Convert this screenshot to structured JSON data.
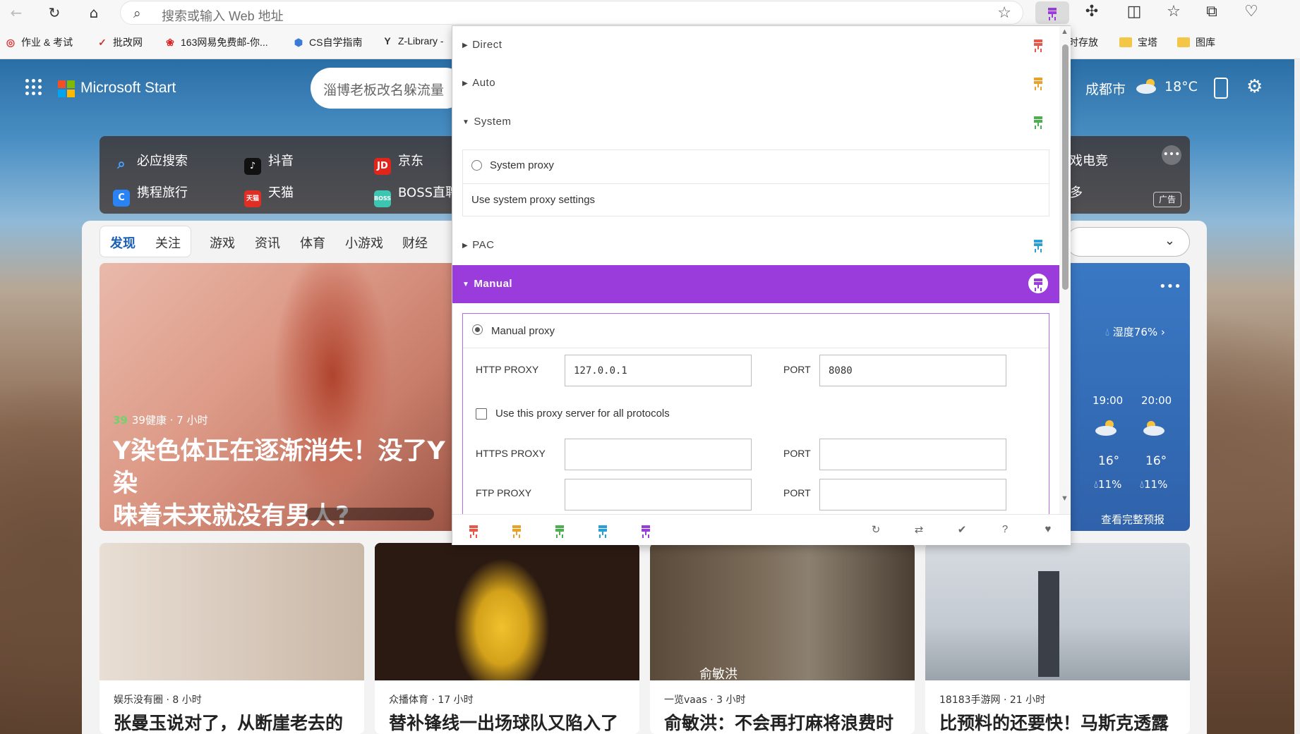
{
  "browser": {
    "address_placeholder": "搜索或输入 Web 地址",
    "bookmarks": [
      {
        "label": "作业 & 考试"
      },
      {
        "label": "批改网"
      },
      {
        "label": "163网易免费邮-你..."
      },
      {
        "label": "CS自学指南"
      },
      {
        "label": "Z-Library -"
      },
      {
        "label": "时存放"
      },
      {
        "label": "宝塔"
      },
      {
        "label": "图库"
      }
    ]
  },
  "ms_start": {
    "title": "Microsoft Start",
    "search_text": "淄博老板改名躲流量",
    "city": "成都市",
    "temp": "18°C",
    "quick_links": [
      "必应搜索",
      "抖音",
      "京东",
      "携程旅行",
      "天猫",
      "BOSS直聘",
      "戏电竞",
      "多"
    ],
    "ad_label": "广告",
    "tabs": [
      "发现",
      "关注",
      "游戏",
      "资讯",
      "体育",
      "小游戏",
      "财经"
    ],
    "hero": {
      "source": "39健康 · 7 小时",
      "title_line1": "Y染色体正在逐渐消失！没了Y染",
      "title_line2": "味着未来就没有男人?",
      "likes": "1"
    },
    "weather_card": {
      "humidity": "湿度76%",
      "hours": [
        {
          "time": "19:00",
          "temp": "16°",
          "rain": "11%"
        },
        {
          "time": "20:00",
          "temp": "16°",
          "rain": "11%"
        }
      ],
      "full_forecast": "查看完整预报"
    },
    "cards": [
      {
        "source": "娱乐没有圈 · 8 小时",
        "title": "张曼玉说对了，从断崖老去的"
      },
      {
        "source": "众播体育 · 17 小时",
        "title": "替补锋线一出场球队又陷入了"
      },
      {
        "source": "一览vaas · 3 小时",
        "title": "俞敏洪：不会再打麻将浪费时",
        "caption": "俞敏洪"
      },
      {
        "source": "18183手游网 · 21 小时",
        "title": "比预料的还要快！马斯克透露"
      }
    ]
  },
  "proxy_popup": {
    "sections": [
      {
        "label": "Direct",
        "expanded": false,
        "color": "#e8584a"
      },
      {
        "label": "Auto",
        "expanded": false,
        "color": "#e8a22a"
      },
      {
        "label": "System",
        "expanded": true,
        "color": "#4caf50"
      },
      {
        "label": "PAC",
        "expanded": false,
        "color": "#2a9fd6"
      },
      {
        "label": "Manual",
        "expanded": true,
        "color": "#9a3cdc"
      }
    ],
    "system": {
      "radio_label": "System proxy",
      "description": "Use system proxy settings"
    },
    "manual": {
      "radio_label": "Manual proxy",
      "http_label": "HTTP PROXY",
      "http_value": "127.0.0.1",
      "port_label": "PORT",
      "http_port": "8080",
      "all_protocols_label": "Use this proxy server for all protocols",
      "https_label": "HTTPS PROXY",
      "https_value": "",
      "https_port": "",
      "ftp_label": "FTP PROXY",
      "ftp_value": "",
      "ftp_port": ""
    },
    "footer_actions": [
      "refresh-icon",
      "swap-icon",
      "check-icon",
      "help-icon",
      "heart-icon"
    ]
  }
}
